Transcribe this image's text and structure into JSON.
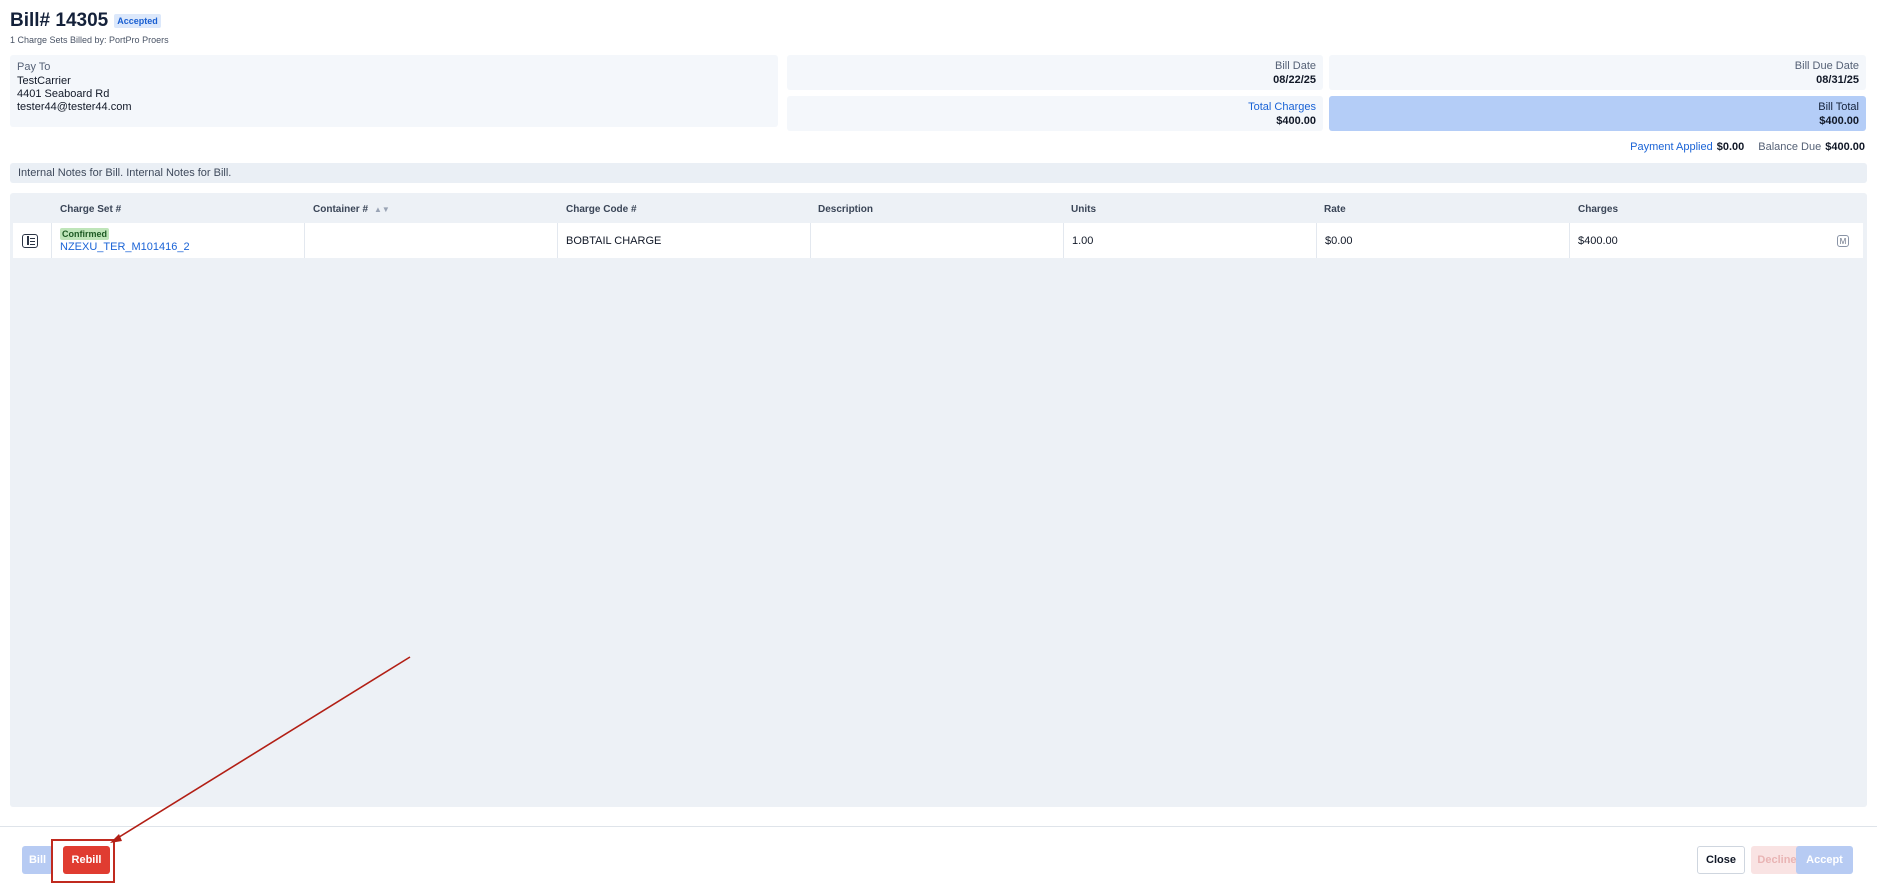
{
  "header": {
    "title": "Bill# 14305",
    "status": "Accepted",
    "subtitle": "1 Charge Sets Billed by: PortPro Proers"
  },
  "pay_to": {
    "label": "Pay To",
    "name": "TestCarrier",
    "address": "4401 Seaboard Rd",
    "email": "tester44@tester44.com"
  },
  "summary": {
    "bill_date_label": "Bill Date",
    "bill_date": "08/22/25",
    "bill_due_date_label": "Bill Due Date",
    "bill_due_date": "08/31/25",
    "total_charges_label": "Total Charges",
    "total_charges": "$400.00",
    "bill_total_label": "Bill Total",
    "bill_total": "$400.00",
    "payment_applied_label": "Payment Applied",
    "payment_applied": "$0.00",
    "balance_due_label": "Balance Due",
    "balance_due": "$400.00"
  },
  "notes": "Internal Notes for Bill. Internal Notes for Bill.",
  "table": {
    "columns": [
      "Charge Set #",
      "Container #",
      "Charge Code #",
      "Description",
      "Units",
      "Rate",
      "Charges"
    ],
    "rows": [
      {
        "status": "Confirmed",
        "charge_set": "NZEXU_TER_M101416_2",
        "container": "",
        "charge_code": "BOBTAIL CHARGE",
        "description": "",
        "units": "1.00",
        "rate": "$0.00",
        "charges": "$400.00"
      }
    ]
  },
  "footer": {
    "bill_label": "Bill",
    "rebill_label": "Rebill",
    "close_label": "Close",
    "decline_label": "Decline",
    "accept_label": "Accept"
  },
  "colors": {
    "accent": "#1a63d6",
    "danger": "#e03c31",
    "total_card": "#b4cdf7"
  }
}
